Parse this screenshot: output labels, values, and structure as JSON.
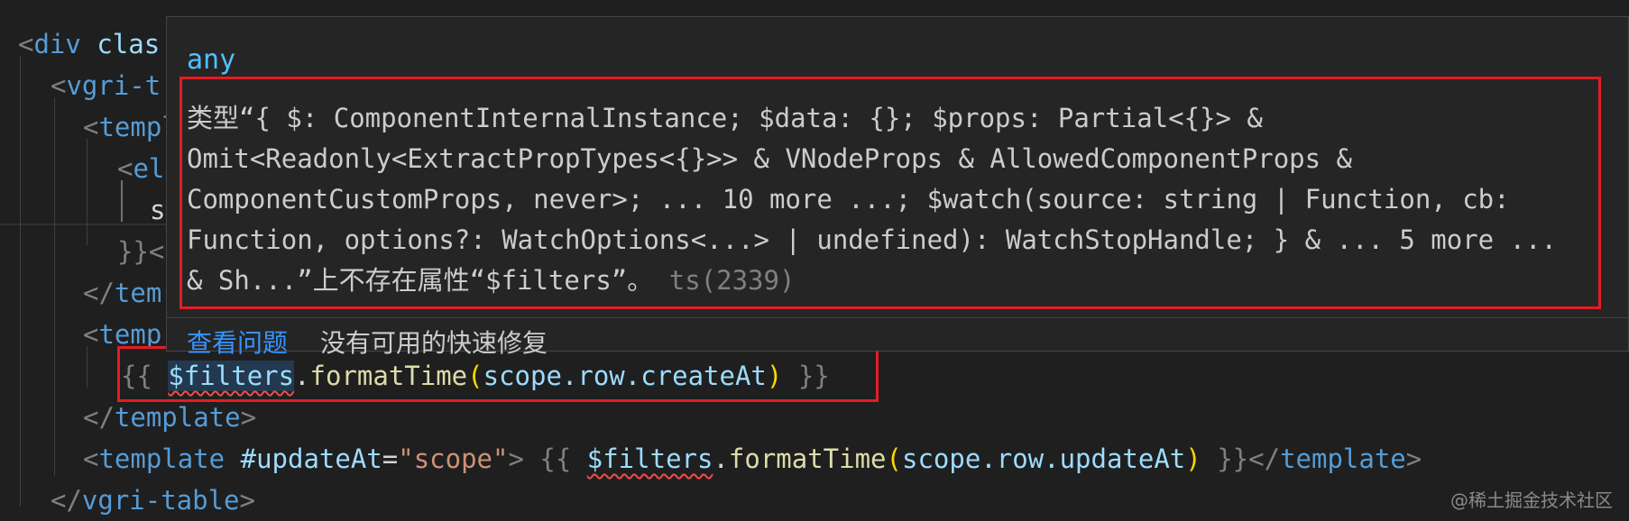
{
  "editor": {
    "lines": {
      "l1": {
        "open": "<",
        "tag": "div",
        "attr": " clas"
      },
      "l2": {
        "open": "<",
        "tag": "vgri-t"
      },
      "l3": {
        "open": "<",
        "tag": "templ"
      },
      "l4": {
        "open": "<",
        "tag": "el"
      },
      "l5": {
        "text": "s"
      },
      "l6": {
        "text": "}}<"
      },
      "l7": {
        "open": "</",
        "tag": "tem"
      },
      "l8": {
        "open": "<",
        "tag": "temp"
      },
      "l9": {
        "mustache_open": "{{ ",
        "var": "$filters",
        "dot": ".",
        "fn": "formatTime",
        "lparen": "(",
        "arg": "scope.row.createAt",
        "rparen": ")",
        "mustache_close": " }}"
      },
      "l10": {
        "open": "</",
        "tag": "template",
        "close": ">"
      },
      "l11": {
        "open": "<",
        "tag": "template",
        "attr": " #updateAt",
        "eq": "=",
        "str": "\"scope\"",
        "gt": ">",
        "mustache_open": " {{ ",
        "var": "$filters",
        "dot": ".",
        "fn": "formatTime",
        "lparen": "(",
        "arg": "scope.row.updateAt",
        "rparen": ")",
        "mustache_close": " }}",
        "end_open": "</",
        "end_tag": "template",
        "end_close": ">"
      },
      "l12": {
        "open": "</",
        "tag": "vgri-table",
        "close": ">"
      }
    }
  },
  "hover": {
    "type": "any",
    "message_lines": [
      "类型“{ $: ComponentInternalInstance; $data: {}; $props: Partial<{}> &",
      "Omit<Readonly<ExtractPropTypes<{}>> & VNodeProps & AllowedComponentProps &",
      "ComponentCustomProps, never>; ... 10 more ...; $watch(source: string | Function, cb:",
      "Function, options?: WatchOptions<...> | undefined): WatchStopHandle; } & ... 5 more ...",
      "& Sh...”上不存在属性“$filters”。"
    ],
    "error_code": " ts(2339)",
    "view_problem": "查看问题",
    "no_fix": "没有可用的快速修复"
  },
  "watermark": "@稀土掘金技术社区",
  "colors": {
    "background": "#1f1f1f",
    "hover_background": "#252526",
    "highlight_box": "#e51c23",
    "link": "#3794ff",
    "type": "#4fc1ff"
  }
}
